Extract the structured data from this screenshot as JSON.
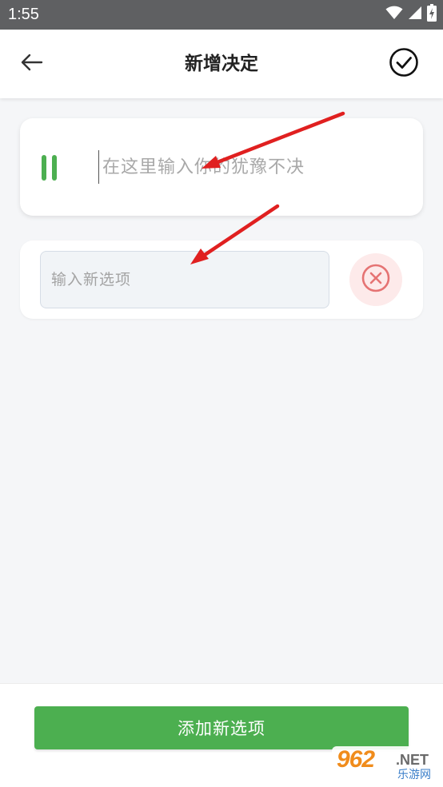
{
  "status_bar": {
    "time": "1:55",
    "icons": [
      "wifi-icon",
      "signal-icon",
      "battery-charging-icon"
    ],
    "background": "#5f6062"
  },
  "app_bar": {
    "title": "新增决定",
    "back_icon": "arrow-left-icon",
    "confirm_icon": "check-circle-icon"
  },
  "question": {
    "placeholder": "在这里输入你的犹豫不决",
    "value": "",
    "indicator_icon": "pause-icon"
  },
  "options": [
    {
      "placeholder": "输入新选项",
      "value": "",
      "delete_icon": "close-circle-icon"
    }
  ],
  "bottom": {
    "add_button_label": "添加新选项"
  },
  "watermark": {
    "main": "962",
    "suffix": ".NET",
    "sub": "乐游网"
  },
  "colors": {
    "accent": "#4caf50",
    "delete_bg": "#fdeaea",
    "delete_icon": "#e57373",
    "annotation_arrow": "#e02020",
    "page_background": "#f5f6f8"
  }
}
